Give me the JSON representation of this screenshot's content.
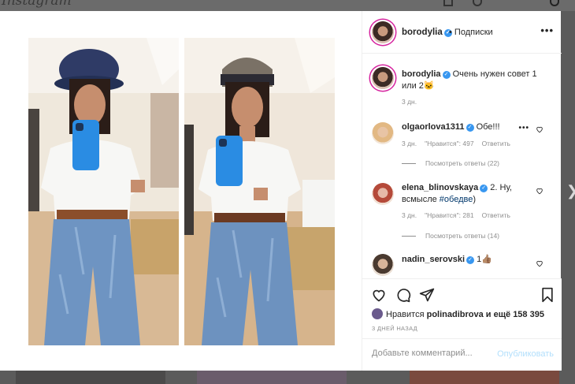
{
  "site": {
    "logo_text": "Instagram"
  },
  "post": {
    "author": "borodylia",
    "follow_label": "• Подписки",
    "caption": "Очень нужен совет 1 или 2🐱",
    "caption_time": "3 дн."
  },
  "comments": [
    {
      "user": "olgaorlova1311",
      "text": "Обе!!!",
      "time": "3 дн.",
      "likes": "\"Нравится\": 497",
      "reply": "Ответить",
      "view_replies": "Посмотреть ответы (22)"
    },
    {
      "user": "elena_blinovskaya",
      "text": "2. Ну, всмысле ",
      "hashtag": "#обедве",
      "text_end": ")",
      "time": "3 дн.",
      "likes": "\"Нравится\": 281",
      "reply": "Ответить",
      "view_replies": "Посмотреть ответы (14)"
    },
    {
      "user": "nadin_serovski",
      "text": "1👍🏽"
    }
  ],
  "footer": {
    "liked_prefix": "Нравится",
    "liked_user": "polinadibrova",
    "liked_suffix": "и ещё 158 395",
    "date": "3 ДНЕЙ НАЗАД",
    "comment_placeholder": "Добавьте комментарий...",
    "publish_label": "Опубликовать"
  },
  "colors": {
    "accent": "#3897f0",
    "ring": "#d6249f",
    "publish_disabled": "#b2dffc"
  },
  "icons": [
    "heart-icon",
    "comment-icon",
    "share-icon",
    "bookmark-icon",
    "more-icon",
    "verified-icon",
    "chevron-right-icon"
  ]
}
